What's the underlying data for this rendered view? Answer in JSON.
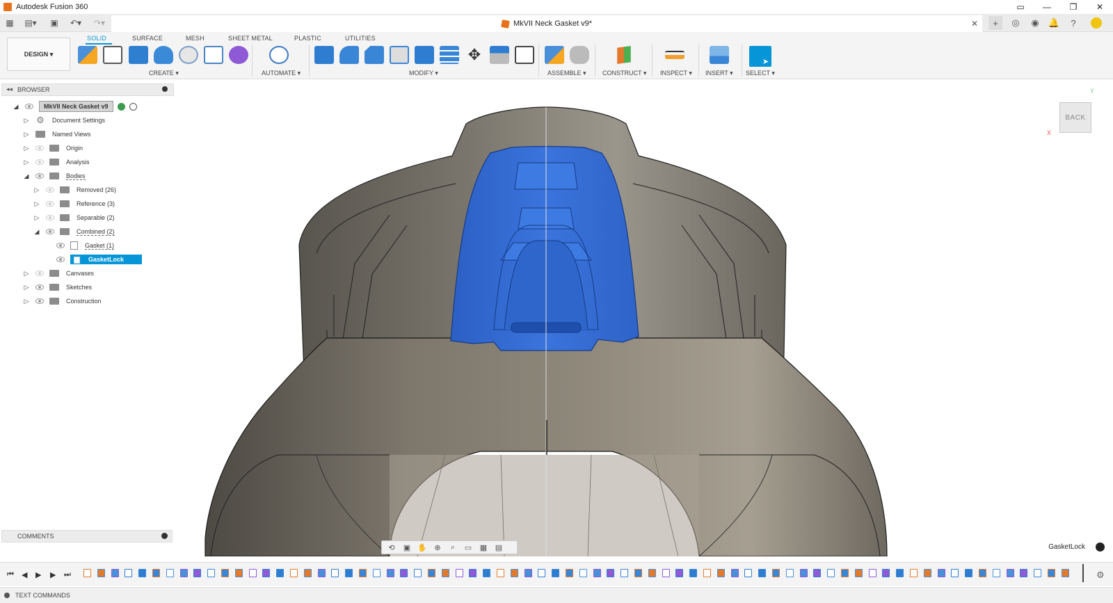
{
  "app": {
    "title": "Autodesk Fusion 360"
  },
  "window": {
    "minimize": "—",
    "restore": "❐",
    "close": "✕"
  },
  "document": {
    "title": "MkVII Neck Gasket v9*",
    "close": "✕"
  },
  "ribbon": {
    "workspace": "DESIGN ▾",
    "tabs": [
      "SOLID",
      "SURFACE",
      "MESH",
      "SHEET METAL",
      "PLASTIC",
      "UTILITIES"
    ],
    "groups": [
      "CREATE ▾",
      "AUTOMATE ▾",
      "MODIFY ▾",
      "ASSEMBLE ▾",
      "CONSTRUCT ▾",
      "INSPECT ▾",
      "INSERT ▾",
      "SELECT ▾"
    ]
  },
  "browser": {
    "title": "BROWSER",
    "root": "MkVII Neck Gasket v9",
    "items": [
      {
        "label": "Document Settings"
      },
      {
        "label": "Named Views"
      },
      {
        "label": "Origin"
      },
      {
        "label": "Analysis"
      },
      {
        "label": "Bodies"
      },
      {
        "label": "Removed (26)"
      },
      {
        "label": "Reference (3)"
      },
      {
        "label": "Separable (2)"
      },
      {
        "label": "Combined (2)"
      },
      {
        "label": "Gasket (1)"
      },
      {
        "label": "GasketLock"
      },
      {
        "label": "Canvases"
      },
      {
        "label": "Sketches"
      },
      {
        "label": "Construction"
      }
    ]
  },
  "viewcube": {
    "face": "BACK",
    "axis_y": "Y",
    "axis_x": "X"
  },
  "comments": {
    "label": "COMMENTS"
  },
  "status": {
    "selection": "GasketLock"
  },
  "text_commands": {
    "label": "TEXT COMMANDS"
  },
  "colors": {
    "accent": "#0696d7",
    "selection_blue": "#2f6fd6",
    "model_gray": "#6d6a63"
  }
}
